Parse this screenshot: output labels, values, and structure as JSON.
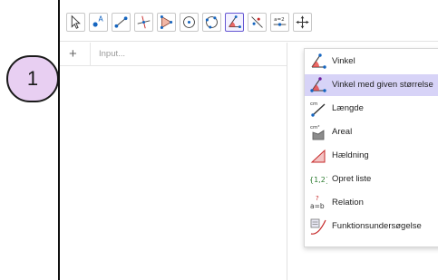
{
  "badge": {
    "number": "1"
  },
  "algebra": {
    "plus": "+",
    "input_placeholder": "Input..."
  },
  "toolbar": {
    "icons": [
      "move",
      "point",
      "segment",
      "perpendicular-line",
      "polygon",
      "circle-center-point",
      "circle-through-3-points",
      "angle",
      "reflect-about-line",
      "slider",
      "move-graphics-view"
    ],
    "active": "angle",
    "slider_label": "a=2",
    "point_label": "A"
  },
  "menu": {
    "items": [
      {
        "label": "Vinkel",
        "icon": "angle-icon",
        "highlighted": false
      },
      {
        "label": "Vinkel med given størrelse",
        "icon": "angle-fixed-icon",
        "highlighted": true
      },
      {
        "label": "Længde",
        "icon": "distance-icon",
        "highlighted": false,
        "icon_text": "cm"
      },
      {
        "label": "Areal",
        "icon": "area-icon",
        "highlighted": false,
        "icon_text": "cm²"
      },
      {
        "label": "Hældning",
        "icon": "slope-icon",
        "highlighted": false
      },
      {
        "label": "Opret liste",
        "icon": "list-icon",
        "highlighted": false,
        "icon_text": "{1,2}"
      },
      {
        "label": "Relation",
        "icon": "relation-icon",
        "highlighted": false,
        "icon_text": "a=b",
        "icon_mark": "?"
      },
      {
        "label": "Funktionsundersøgelse",
        "icon": "function-inspector-icon",
        "highlighted": false
      }
    ]
  },
  "colors": {
    "accent": "#6557d2",
    "highlight": "#d7d3f7",
    "badge": "#e8cff2",
    "point": "#1565c0",
    "angle_fill": "#e53935"
  }
}
